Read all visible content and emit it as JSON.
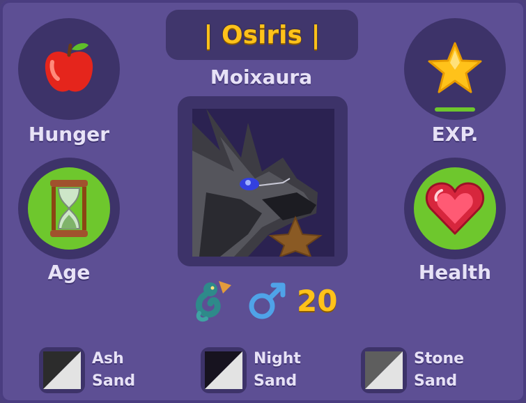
{
  "pet": {
    "name": "| Osiris |",
    "species": "Moixaura",
    "level": "20"
  },
  "stats": {
    "hunger": {
      "label": "Hunger",
      "icon": "apple-icon"
    },
    "exp": {
      "label": "EXP.",
      "icon": "star-icon"
    },
    "age": {
      "label": "Age",
      "icon": "hourglass-icon"
    },
    "health": {
      "label": "Health",
      "icon": "heart-icon"
    }
  },
  "info": {
    "dragon_icon": "dragon-icon",
    "gender_icon": "male-symbol-icon"
  },
  "genes": [
    {
      "line1": "Ash",
      "line2": "Sand",
      "dark_color": "#2c2c2c",
      "light_color": "#e3e3e3"
    },
    {
      "line1": "Night",
      "line2": "Sand",
      "dark_color": "#17131f",
      "light_color": "#e3e3e3"
    },
    {
      "line1": "Stone",
      "line2": "Sand",
      "dark_color": "#5e5e5e",
      "light_color": "#e3e3e3"
    }
  ],
  "colors": {
    "panel": "#5d4f94",
    "well": "#3d3369",
    "green": "#6ec72d",
    "gold": "#ffc21a",
    "exp_bar": "#6ec72d"
  }
}
